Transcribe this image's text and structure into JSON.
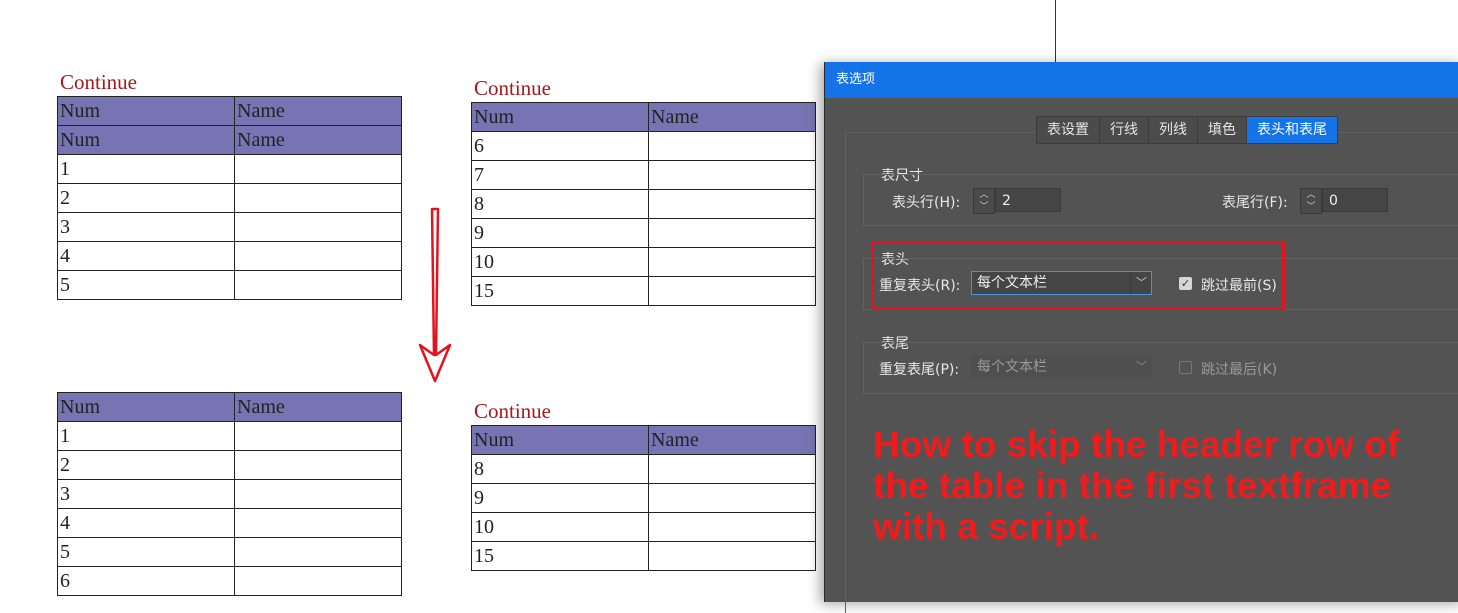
{
  "tables": [
    {
      "caption": "Continue",
      "rows": [
        [
          "Num",
          "Name"
        ],
        [
          "Num",
          "Name"
        ],
        [
          "1",
          ""
        ],
        [
          "2",
          ""
        ],
        [
          "3",
          ""
        ],
        [
          "4",
          ""
        ],
        [
          "5",
          ""
        ]
      ],
      "header_rows": 2
    },
    {
      "caption": "Continue",
      "rows": [
        [
          "Num",
          "Name"
        ],
        [
          "6",
          ""
        ],
        [
          "7",
          ""
        ],
        [
          "8",
          ""
        ],
        [
          "9",
          ""
        ],
        [
          "10",
          ""
        ],
        [
          "15",
          ""
        ]
      ],
      "header_rows": 1
    },
    {
      "caption": "",
      "rows": [
        [
          "Num",
          "Name"
        ],
        [
          "1",
          ""
        ],
        [
          "2",
          ""
        ],
        [
          "3",
          ""
        ],
        [
          "4",
          ""
        ],
        [
          "5",
          ""
        ],
        [
          "6",
          ""
        ]
      ],
      "header_rows": 1
    },
    {
      "caption": "Continue",
      "rows": [
        [
          "Num",
          "Name"
        ],
        [
          "8",
          ""
        ],
        [
          "9",
          ""
        ],
        [
          "10",
          ""
        ],
        [
          "15",
          ""
        ]
      ],
      "header_rows": 1
    }
  ],
  "colors": {
    "caption": "#a3191d",
    "header_fill": "#7674b2",
    "dialog_bg": "#535353",
    "accent": "#1473e6",
    "annotation_red": "#ee1c1c"
  },
  "dialog": {
    "title": "表选项",
    "tabs": [
      {
        "label": "表设置",
        "active": false
      },
      {
        "label": "行线",
        "active": false
      },
      {
        "label": "列线",
        "active": false
      },
      {
        "label": "填色",
        "active": false
      },
      {
        "label": "表头和表尾",
        "active": true
      }
    ],
    "table_size": {
      "title": "表尺寸",
      "header_rows_label": "表头行(H):",
      "header_rows_value": "2",
      "footer_rows_label": "表尾行(F):",
      "footer_rows_value": "0"
    },
    "header": {
      "title": "表头",
      "repeat_label": "重复表头(R):",
      "repeat_value": "每个文本栏",
      "skip_first_label": "跳过最前(S)",
      "skip_first_checked": true
    },
    "footer": {
      "title": "表尾",
      "repeat_label": "重复表尾(P):",
      "repeat_value": "每个文本栏",
      "skip_last_label": "跳过最后(K)",
      "skip_last_checked": false
    }
  },
  "annotation": "How to skip the header row of the table in the first textframe with a script.",
  "icons": {
    "arrow": "down-arrow-icon",
    "spinner": "spinner-icon",
    "chevron": "chevron-down-icon",
    "check": "check-icon"
  }
}
